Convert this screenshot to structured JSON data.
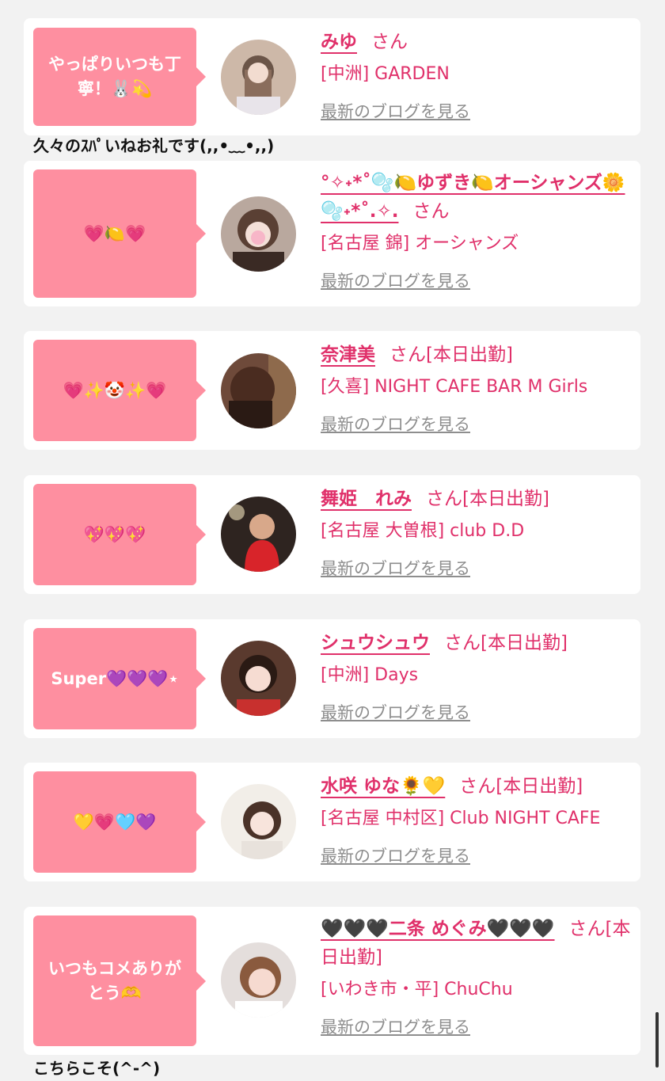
{
  "entries": [
    {
      "bubble": "やっぱりいつも丁寧！🐰💫",
      "name": "みゆ",
      "san": "さん",
      "status": "",
      "shop": "[中洲] GARDEN",
      "blog": "最新のブログを見る",
      "reply": "久々のｽﾊﾟいねお礼です(,,•﹏•,,)"
    },
    {
      "bubble": "💗🍋💗",
      "name": "°✧˖*˚🫧🍋ゆずき🍋オーシャンズ🌼🫧˖*˚.✧.",
      "san": "さん",
      "status": "",
      "shop": "[名古屋 錦] オーシャンズ",
      "blog": "最新のブログを見る",
      "reply": ""
    },
    {
      "bubble": "💗✨🤡✨💗",
      "name": "奈津美",
      "san": "さん",
      "status": "[本日出勤]",
      "shop": "[久喜] NIGHT CAFE BAR M Girls",
      "blog": "最新のブログを見る",
      "reply": ""
    },
    {
      "bubble": "💖💖💖",
      "name": "舞姫　れみ",
      "san": "さん",
      "status": "[本日出勤]",
      "shop": "[名古屋 大曽根] club D.D",
      "blog": "最新のブログを見る",
      "reply": ""
    },
    {
      "bubble": "Super💜💜💜⋆",
      "name": "シュウシュウ",
      "san": "さん",
      "status": "[本日出勤]",
      "shop": "[中洲] Days",
      "blog": "最新のブログを見る",
      "reply": ""
    },
    {
      "bubble": "💛💗🩵💜",
      "name": "水咲 ゆな🌻💛",
      "san": "さん",
      "status": "[本日出勤]",
      "shop": "[名古屋 中村区] Club NIGHT CAFE",
      "blog": "最新のブログを見る",
      "reply": ""
    },
    {
      "bubble": "いつもコメありがとう🫶",
      "name": "🖤🖤🖤二条 めぐみ🖤🖤🖤",
      "san": "さん",
      "status": "[本日出勤]",
      "shop": "[いわき市・平] ChuChu",
      "blog": "最新のブログを見る",
      "reply": "こちらこそ(^-^)"
    }
  ],
  "colors": {
    "bubble": "#fe8fa0",
    "accent": "#e0306a",
    "link": "#8e8e8e"
  }
}
